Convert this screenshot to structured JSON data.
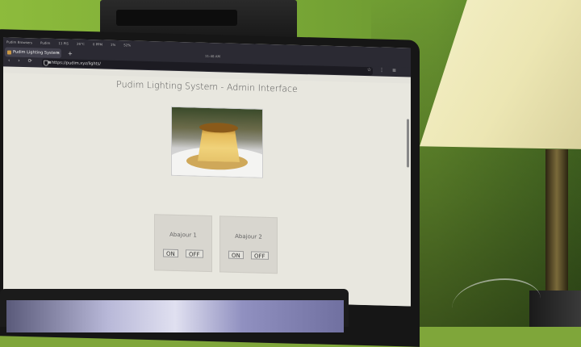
{
  "browser": {
    "bookmarks": [
      "Pudim Browsers",
      "Pudim",
      "11 PIS",
      "26°C",
      "0 PPM",
      "1%",
      "52%"
    ],
    "tab_title": "Pudim Lighting System",
    "tab_close": "×",
    "new_tab": "+",
    "clock": "11:48 AM",
    "url": "https://pudim.xyz/lights/",
    "nav_icons": "‹ › ⟳",
    "menu_icons": "☆ ⋮ ≡"
  },
  "page": {
    "title": "Pudim Lighting System - Admin Interface",
    "devices": [
      {
        "name": "Abajour 1",
        "on_label": "ON",
        "off_label": "OFF"
      },
      {
        "name": "Abajour 2",
        "on_label": "ON",
        "off_label": "OFF"
      }
    ]
  },
  "colors": {
    "wall": "#7aa936",
    "lampshade": "#ece6b3",
    "page_bg": "#e8e7df",
    "card_bg": "#d8d6cf"
  }
}
